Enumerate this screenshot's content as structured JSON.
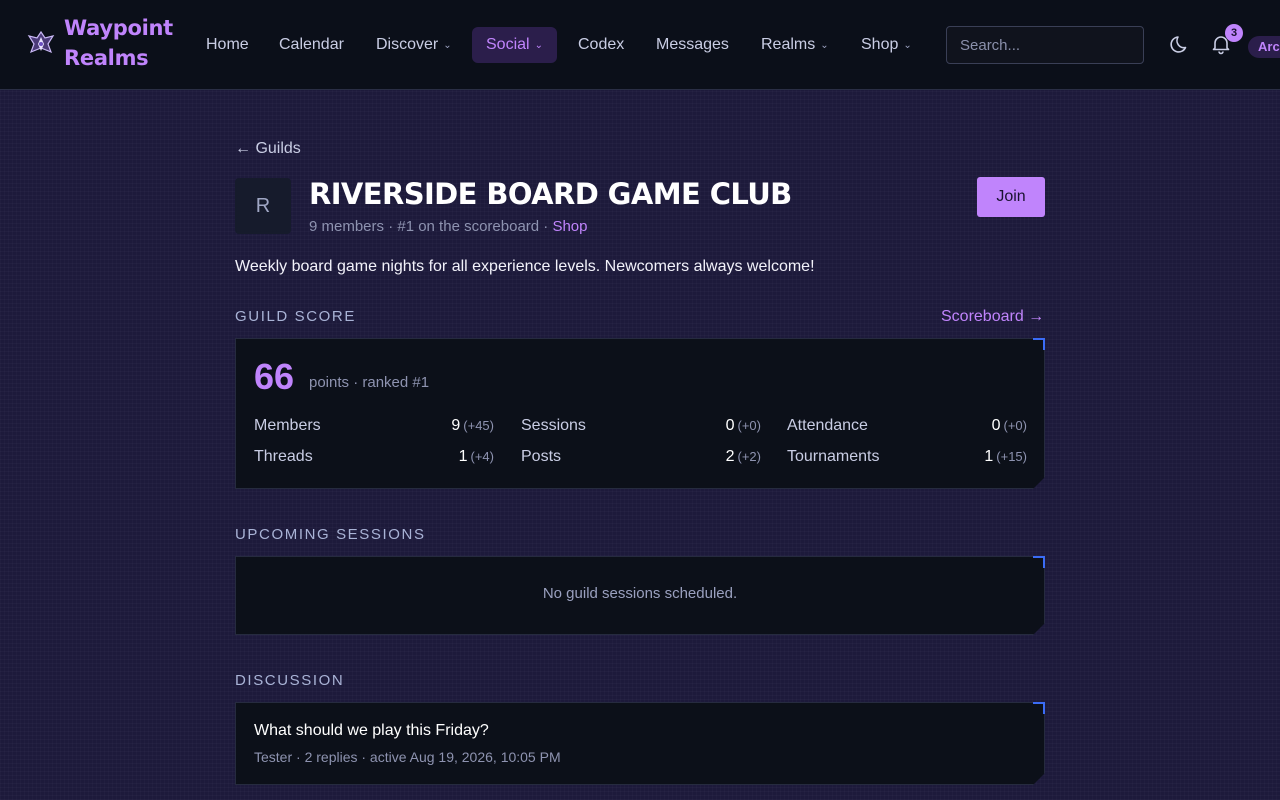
{
  "nav": {
    "brand_line1": "Waypoint",
    "brand_line2": "Realms",
    "items": [
      {
        "label": "Home",
        "chevron": ""
      },
      {
        "label": "Calendar",
        "chevron": ""
      },
      {
        "label": "Discover",
        "chevron": "⌄"
      },
      {
        "label": "Social",
        "chevron": "⌄",
        "active": true
      },
      {
        "label": "Codex",
        "chevron": ""
      },
      {
        "label": "Messages",
        "chevron": ""
      },
      {
        "label": "Realms",
        "chevron": "⌄"
      },
      {
        "label": "Shop",
        "chevron": "⌄"
      }
    ],
    "search_placeholder": "Search...",
    "notification_count": "3",
    "user_label": "Arc"
  },
  "guild": {
    "back_label": "← Guilds",
    "avatar_initial": "R",
    "name": "Riverside Board Game Club",
    "meta_text": "9 members · #1 on the scoreboard · ",
    "shop_link": "Shop",
    "join_label": "Join",
    "description": "Weekly board game nights for all experience levels. Newcomers always welcome!"
  },
  "score": {
    "section_label": "Guild Score",
    "scoreboard_link": "Scoreboard →",
    "points": "66",
    "points_text": "points · ranked #1",
    "stats": [
      {
        "label": "Members",
        "value": "9",
        "delta": "(+45)"
      },
      {
        "label": "Sessions",
        "value": "0",
        "delta": "(+0)"
      },
      {
        "label": "Attendance",
        "value": "0",
        "delta": "(+0)"
      },
      {
        "label": "Threads",
        "value": "1",
        "delta": "(+4)"
      },
      {
        "label": "Posts",
        "value": "2",
        "delta": "(+2)"
      },
      {
        "label": "Tournaments",
        "value": "1",
        "delta": "(+15)"
      }
    ]
  },
  "sessions": {
    "section_label": "Upcoming Sessions",
    "empty_text": "No guild sessions scheduled."
  },
  "discussion": {
    "section_label": "Discussion",
    "threads": [
      {
        "title": "What should we play this Friday?",
        "meta": "Tester · 2 replies · active Aug 19, 2026, 10:05 PM"
      }
    ]
  },
  "colors": {
    "accent": "#c084fc",
    "corner_accent": "#3b6cf6",
    "page_bg": "#1d1a3b",
    "card_bg": "#0c1019",
    "nav_bg": "#0b0f19"
  },
  "icons": [
    "waypoint-logo-icon",
    "chevron-down-icon",
    "moon-icon",
    "bell-icon"
  ]
}
